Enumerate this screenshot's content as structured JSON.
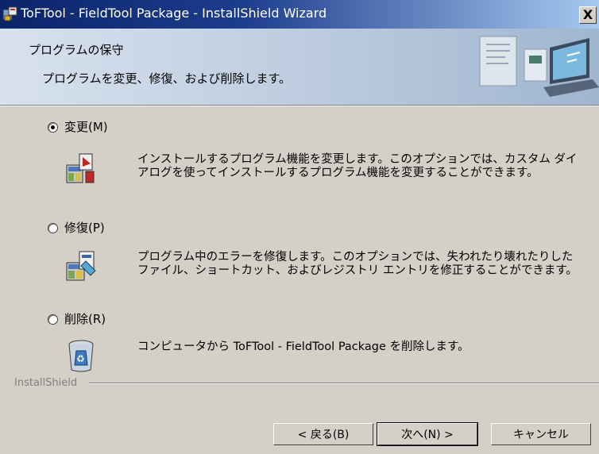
{
  "window": {
    "title": "ToFTool - FieldTool Package - InstallShield Wizard",
    "close_label": "X"
  },
  "header": {
    "title": "プログラムの保守",
    "subtitle": "プログラムを変更、修復、および削除します。"
  },
  "options": [
    {
      "label": "変更(M)",
      "selected": true,
      "icon": "modify-icon",
      "description": "インストールするプログラム機能を変更します。このオプションでは、カスタム ダイアログを使ってインストールするプログラム機能を変更することができます。"
    },
    {
      "label": "修復(P)",
      "selected": false,
      "icon": "repair-icon",
      "description": "プログラム中のエラーを修復します。このオプションでは、失われたり壊れたりしたファイル、ショートカット、およびレジストリ エントリを修正することができます。"
    },
    {
      "label": "削除(R)",
      "selected": false,
      "icon": "remove-icon",
      "description": "コンピュータから ToFTool - FieldTool Package を削除します。"
    }
  ],
  "footer": {
    "brand": "InstallShield",
    "back_label": "< 戻る(B)",
    "next_label": "次へ(N) >",
    "cancel_label": "キャンセル"
  },
  "colors": {
    "titlebar_start": "#0a246a",
    "titlebar_end": "#a6caf0",
    "dialog_face": "#d4d0c8",
    "banner": "#c8d6e6"
  }
}
